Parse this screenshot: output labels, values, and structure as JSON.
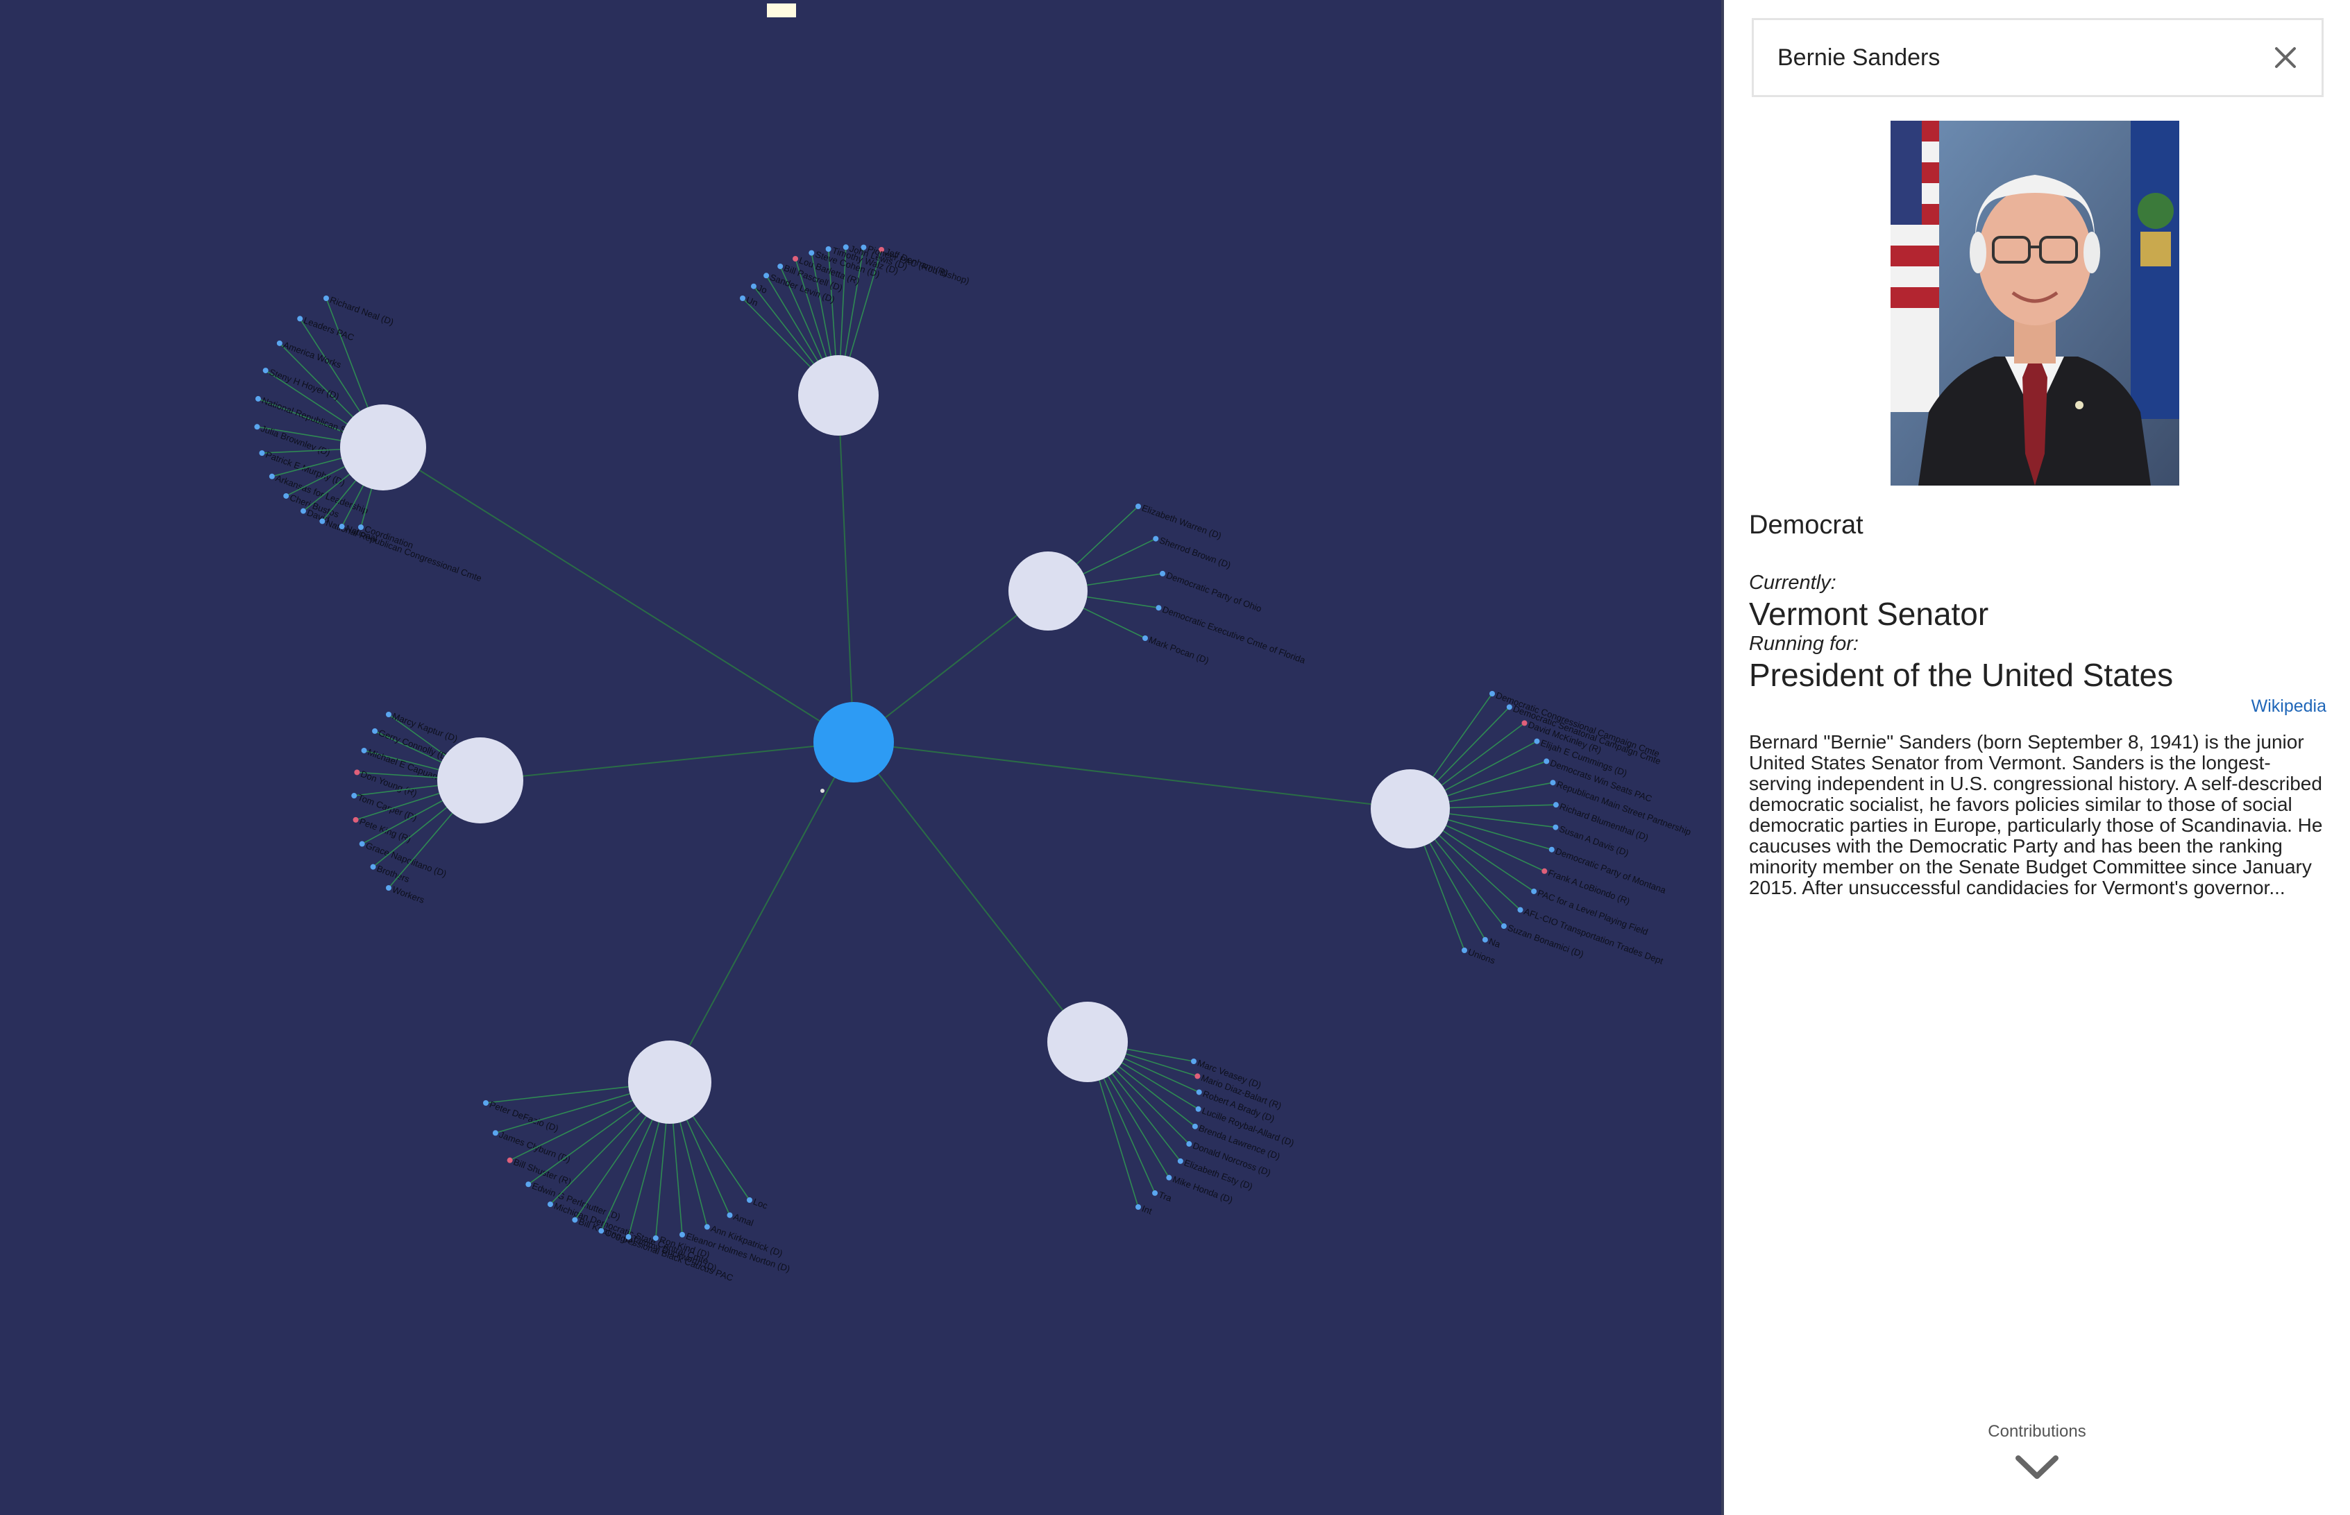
{
  "graph": {
    "center_color": "#2d9bf4",
    "cluster_color": "#dcdff0",
    "background_color": "#2a2f5b",
    "clusters": [
      {
        "labels": [
          "Jeff Denham (R)",
          "Pioneer PAC (Rob Bishop)",
          "John Lewis (D)",
          "Timothy Walz (D)",
          "Steve Cohen (D)",
          "Lou Barletta (R)",
          "Bill Pascrell (D)",
          "Sander Levin (D)",
          "Jo",
          "Un"
        ]
      },
      {
        "labels": [
          "Richard Neal (D)",
          "Leaders PAC",
          "America Works",
          "Steny H Hoyer (D)",
          "National Republican Senatorial Cmte",
          "Julia Brownley (D)",
          "Patrick E Murphy (D)",
          "Arkansas for Leadership",
          "Cheri Bustos",
          "David ...",
          "National Republican Congressional Cmte",
          "National",
          "Coordination"
        ]
      },
      {
        "labels": [
          "Elizabeth Warren (D)",
          "Sherrod Brown (D)",
          "Democratic Party of Ohio",
          "Democratic Executive Cmte of Florida",
          "Mark Pocan (D)"
        ]
      },
      {
        "labels": [
          "Marcy Kaptur (D)",
          "Gerry Connolly (D)",
          "Michael E Capuano (D)",
          "Don Young (R)",
          "Tom Carper (D)",
          "Pete King (R)",
          "Grace Napolitano (D)",
          "Brothers",
          "Workers"
        ]
      },
      {
        "labels": [
          "Democratic Congressional Campaign Cmte",
          "Democratic Senatorial Campaign Cmte",
          "David McKinley (R)",
          "Elijah E Cummings (D)",
          "Democrats Win Seats PAC",
          "Republican Main Street Partnership",
          "Richard Blumenthal (D)",
          "Susan A Davis (D)",
          "Democratic Party of Montana",
          "Frank A LoBiondo (R)",
          "PAC for a Level Playing Field",
          "AFL-CIO Transportation Trades Dept",
          "Suzan Bonamici (D)",
          "Na",
          "Unions"
        ]
      },
      {
        "labels": [
          "Peter DeFazio (D)",
          "James Clyburn (D)",
          "Bill Shuster (R)",
          "Edwin G Perlmutter (D)",
          "Michigan Democratic State Central Cmte",
          "Bill Keating (D)",
          "Congressional Black Caucus PAC",
          "Tammy Duckworth (D)",
          "Ron Kind (D)",
          "Eleanor Holmes Norton (D)",
          "Ann Kirkpatrick (D)",
          "Amal",
          "Loc"
        ]
      },
      {
        "labels": [
          "Marc Veasey (D)",
          "Mario Diaz-Balart (R)",
          "Robert A Brady (D)",
          "Lucille Roybal-Allard (D)",
          "Brenda Lawrence (D)",
          "Donald Norcross (D)",
          "Elizabeth Esty (D)",
          "Mike Honda (D)",
          "Tra",
          "Int"
        ]
      }
    ]
  },
  "panel": {
    "search_value": "Bernie Sanders",
    "party": "Democrat",
    "currently_label": "Currently:",
    "current_office": "Vermont Senator",
    "running_label": "Running for:",
    "running_office": "President of the United States",
    "wiki_link": "Wikipedia",
    "bio": "Bernard \"Bernie\" Sanders (born September 8, 1941) is the junior United States Senator from Vermont. Sanders is the longest-serving independent in U.S. congressional history. A self-described democratic socialist, he favors policies similar to those of social democratic parties in Europe, particularly those of Scandinavia. He caucuses with the Democratic Party and has been the ranking minority member on the Senate Budget Committee since January 2015. After unsuccessful candidacies for Vermont's governor...",
    "contributions_label": "Contributions",
    "icons": [
      "close-icon",
      "chevron-down-icon"
    ]
  }
}
